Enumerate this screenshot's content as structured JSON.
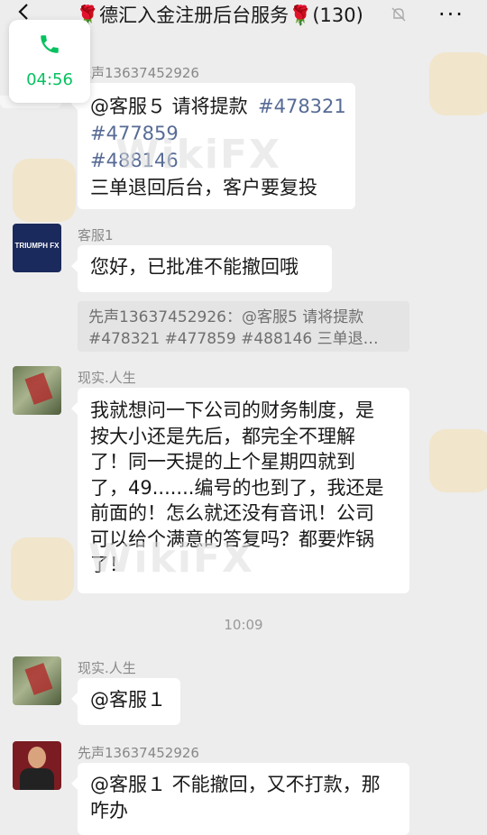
{
  "header": {
    "title": "德汇入金注册后台服务",
    "member_count": "(130)",
    "rose_glyph": "🌹"
  },
  "call": {
    "duration": "04:56"
  },
  "messages": [
    {
      "sender": "先声13637452926",
      "lines": [
        "@客服５  请将提款",
        "#478321",
        "#477859",
        "#488146",
        "三单退回后台，客户要复投"
      ]
    },
    {
      "sender": "客服1",
      "lines": [
        "您好，已批准不能撤回哦"
      ],
      "quote_lines": [
        "先声13637452926：@客服5  请将提款",
        "#478321  #477859  #488146  三单退…"
      ]
    },
    {
      "sender": "现实.人生",
      "lines": [
        "我就想问一下公司的财务制度，是",
        "按大小还是先后，都完全不理解",
        "了！同一天提的上个星期四就到",
        "了，49.......编号的也到了，我还是",
        "前面的！怎么就还没有音讯！公司",
        "可以给个满意的答复吗？都要炸锅",
        "了！"
      ]
    },
    {
      "time": "10:09"
    },
    {
      "sender": "现实.人生",
      "lines": [
        "@客服１"
      ]
    },
    {
      "sender": "先声13637452926",
      "lines": [
        "@客服１  不能撤回，又不打款，那",
        "咋办"
      ]
    }
  ],
  "watermark": {
    "text": "WikiFX"
  },
  "avatars": {
    "kefu_logo": "TRIUMPH FX"
  },
  "colors": {
    "bubble": "#ffffff",
    "background": "#ededed",
    "link": "#576b95",
    "call_green": "#07c160"
  }
}
